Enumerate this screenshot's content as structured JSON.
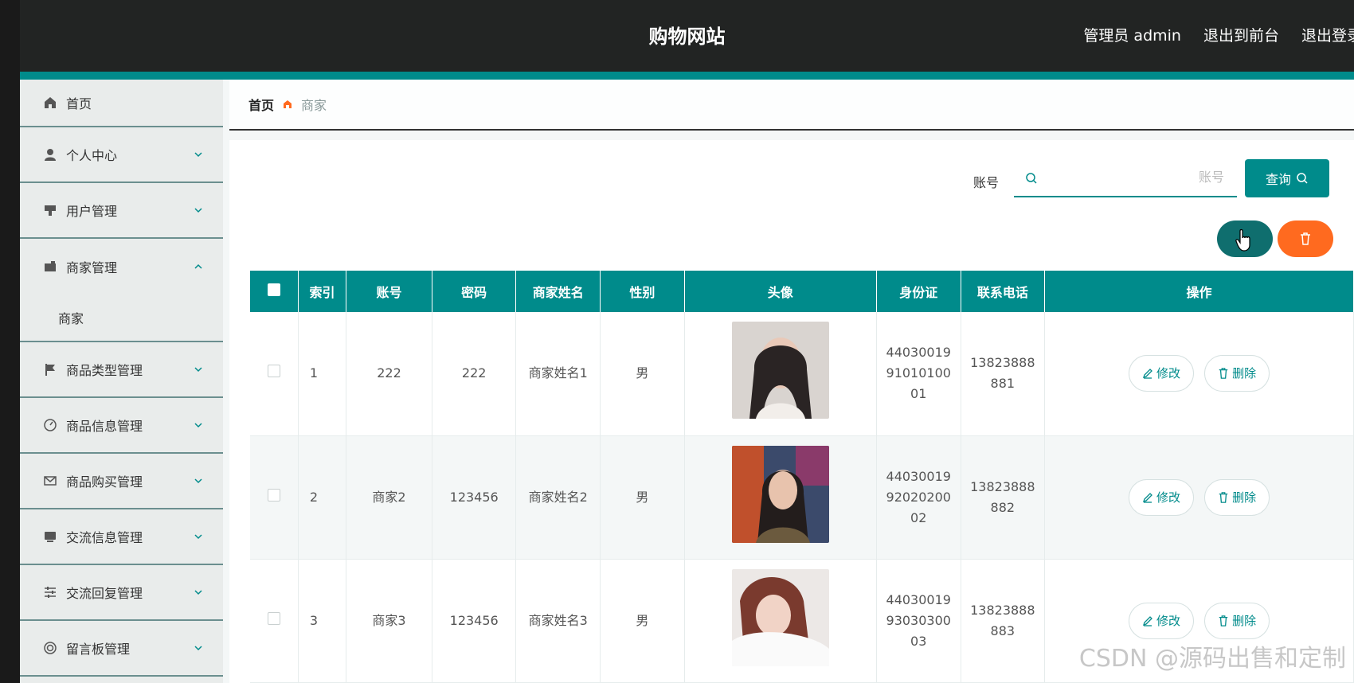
{
  "header": {
    "title": "购物网站",
    "admin_label": "管理员 admin",
    "exit_front": "退出到前台",
    "logout": "退出登录"
  },
  "sidebar": {
    "items": [
      {
        "label": "首页",
        "icon": "home-icon"
      },
      {
        "label": "个人中心",
        "icon": "user-icon"
      },
      {
        "label": "用户管理",
        "icon": "users-icon"
      },
      {
        "label": "商家管理",
        "icon": "wallet-icon",
        "expanded": true
      },
      {
        "label": "商品类型管理",
        "icon": "flag-icon"
      },
      {
        "label": "商品信息管理",
        "icon": "gauge-icon"
      },
      {
        "label": "商品购买管理",
        "icon": "mail-icon"
      },
      {
        "label": "交流信息管理",
        "icon": "monitor-icon"
      },
      {
        "label": "交流回复管理",
        "icon": "sliders-icon"
      },
      {
        "label": "留言板管理",
        "icon": "target-icon"
      }
    ],
    "submenu_label": "商家"
  },
  "breadcrumb": {
    "home": "首页",
    "current": "商家"
  },
  "search": {
    "label": "账号",
    "placeholder": "账号",
    "button": "查询"
  },
  "table": {
    "headers": [
      "索引",
      "账号",
      "密码",
      "商家姓名",
      "性别",
      "头像",
      "身份证",
      "联系电话",
      "操作"
    ],
    "rows": [
      {
        "index": "1",
        "account": "222",
        "password": "222",
        "name": "商家姓名1",
        "gender": "男",
        "id_card": "440300199101010001",
        "phone": "13823888881"
      },
      {
        "index": "2",
        "account": "商家2",
        "password": "123456",
        "name": "商家姓名2",
        "gender": "男",
        "id_card": "440300199202020002",
        "phone": "13823888882"
      },
      {
        "index": "3",
        "account": "商家3",
        "password": "123456",
        "name": "商家姓名3",
        "gender": "男",
        "id_card": "440300199303030003",
        "phone": "13823888883"
      }
    ],
    "edit_label": "修改",
    "delete_label": "删除"
  },
  "watermark": "CSDN @源码出售和定制",
  "colors": {
    "primary": "#008b8b",
    "danger": "#ff6a1f",
    "header_bg": "#222423"
  }
}
